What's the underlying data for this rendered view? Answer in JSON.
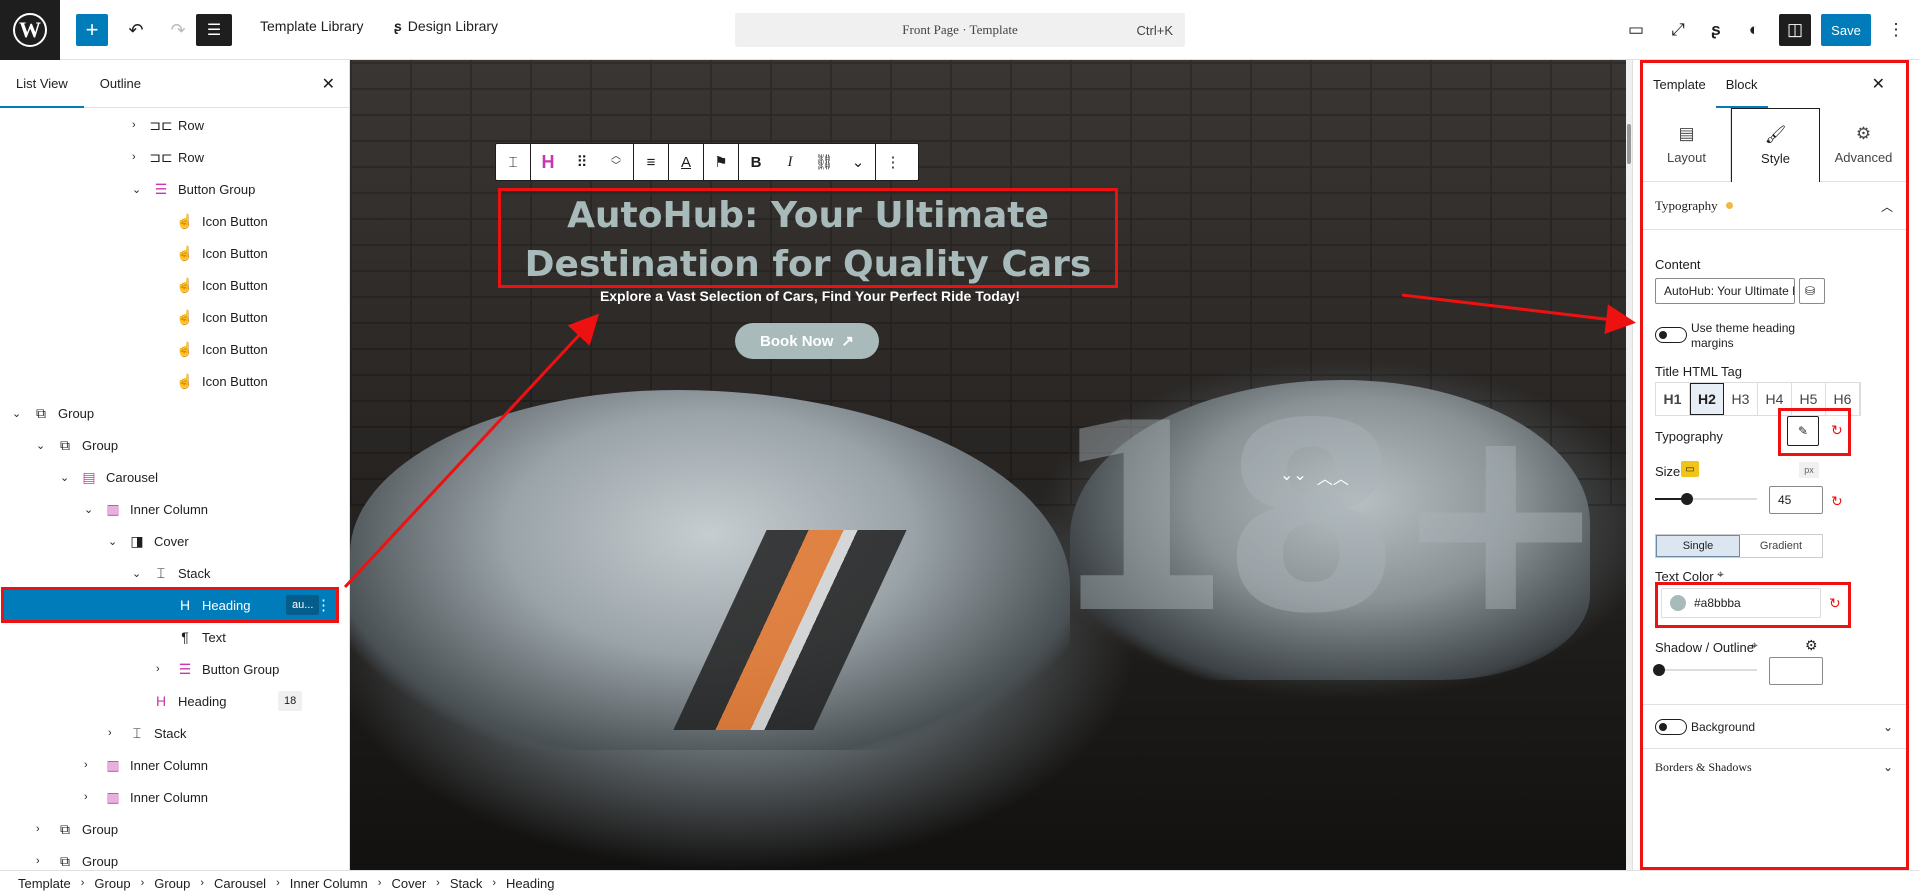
{
  "topbar": {
    "template_library": "Template Library",
    "design_library": "Design Library",
    "doc_title": "Front Page · Template",
    "shortcut": "Ctrl+K",
    "save": "Save"
  },
  "list_panel": {
    "tabs": [
      "List View",
      "Outline"
    ],
    "rows": [
      {
        "label": "Row",
        "indent": 5,
        "chev": "›",
        "icon": "row-icon",
        "glyph": "⊐⊏"
      },
      {
        "label": "Row",
        "indent": 5,
        "chev": "›",
        "icon": "row-icon",
        "glyph": "⊐⊏"
      },
      {
        "label": "Button Group",
        "indent": 5,
        "chev": "⌄",
        "icon": "button-group-icon",
        "glyph": "☰"
      },
      {
        "label": "Icon Button",
        "indent": 6,
        "chev": "",
        "icon": "icon-button-icon",
        "glyph": "☝"
      },
      {
        "label": "Icon Button",
        "indent": 6,
        "chev": "",
        "icon": "icon-button-icon",
        "glyph": "☝"
      },
      {
        "label": "Icon Button",
        "indent": 6,
        "chev": "",
        "icon": "icon-button-icon",
        "glyph": "☝"
      },
      {
        "label": "Icon Button",
        "indent": 6,
        "chev": "",
        "icon": "icon-button-icon",
        "glyph": "☝"
      },
      {
        "label": "Icon Button",
        "indent": 6,
        "chev": "",
        "icon": "icon-button-icon",
        "glyph": "☝"
      },
      {
        "label": "Icon Button",
        "indent": 6,
        "chev": "",
        "icon": "icon-button-icon",
        "glyph": "☝"
      },
      {
        "label": "Group",
        "indent": 0,
        "chev": "⌄",
        "icon": "group-icon",
        "glyph": "⧉"
      },
      {
        "label": "Group",
        "indent": 1,
        "chev": "⌄",
        "icon": "group-icon",
        "glyph": "⧉"
      },
      {
        "label": "Carousel",
        "indent": 2,
        "chev": "⌄",
        "icon": "carousel-icon",
        "glyph": "▤"
      },
      {
        "label": "Inner Column",
        "indent": 3,
        "chev": "⌄",
        "icon": "column-icon",
        "glyph": "▥"
      },
      {
        "label": "Cover",
        "indent": 4,
        "chev": "⌄",
        "icon": "cover-icon",
        "glyph": "◨"
      },
      {
        "label": "Stack",
        "indent": 5,
        "chev": "⌄",
        "icon": "stack-icon",
        "glyph": "⌶"
      },
      {
        "label": "Heading",
        "indent": 6,
        "chev": "",
        "icon": "heading-icon",
        "glyph": "H",
        "badge": "au...",
        "selected": true
      },
      {
        "label": "Text",
        "indent": 6,
        "chev": "",
        "icon": "paragraph-icon",
        "glyph": "¶"
      },
      {
        "label": "Button Group",
        "indent": 6,
        "chev": "›",
        "icon": "button-group-icon",
        "glyph": "☰"
      },
      {
        "label": "Heading",
        "indent": 5,
        "chev": "",
        "icon": "heading-icon",
        "glyph": "H",
        "badge": "18"
      },
      {
        "label": "Stack",
        "indent": 4,
        "chev": "›",
        "icon": "stack-icon",
        "glyph": "⌶"
      },
      {
        "label": "Inner Column",
        "indent": 3,
        "chev": "›",
        "icon": "column-icon",
        "glyph": "▥"
      },
      {
        "label": "Inner Column",
        "indent": 3,
        "chev": "›",
        "icon": "column-icon",
        "glyph": "▥"
      },
      {
        "label": "Group",
        "indent": 1,
        "chev": "›",
        "icon": "group-icon",
        "glyph": "⧉"
      },
      {
        "label": "Group",
        "indent": 1,
        "chev": "›",
        "icon": "group-icon",
        "glyph": "⧉"
      }
    ]
  },
  "canvas": {
    "headline": "AutoHub: Your Ultimate Destination for Quality Cars",
    "subtitle": "Explore a Vast Selection of Cars, Find Your Perfect Ride Today!",
    "cta": "Book Now",
    "big_number": "18+"
  },
  "inspector": {
    "tabs": [
      "Template",
      "Block"
    ],
    "subtabs": [
      "Layout",
      "Style",
      "Advanced"
    ],
    "section": "Typography",
    "content_label": "Content",
    "content_value": "AutoHub: Your Ultimate Destination for Quality Cars",
    "theme_margins": "Use theme heading margins",
    "html_tag_label": "Title HTML Tag",
    "html_tags": [
      "H1",
      "H2",
      "H3",
      "H4",
      "H5",
      "H6"
    ],
    "typography_label": "Typography",
    "size_label": "Size",
    "size_unit": "px",
    "size_value": "45",
    "color_modes": [
      "Single",
      "Gradient"
    ],
    "text_color_label": "Text Color",
    "text_color": "#a8bbba",
    "shadow_label": "Shadow / Outline",
    "background_label": "Background",
    "borders_label": "Borders & Shadows"
  },
  "breadcrumbs": [
    "Template",
    "Group",
    "Group",
    "Carousel",
    "Inner Column",
    "Cover",
    "Stack",
    "Heading"
  ],
  "colors": {
    "accent": "#007cba",
    "annotation": "#ee1111",
    "heading_color": "#a8bbba"
  }
}
